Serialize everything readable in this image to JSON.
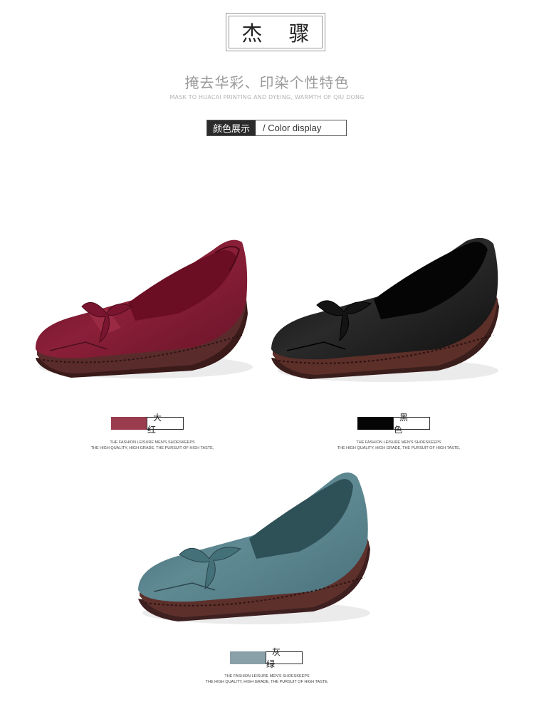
{
  "header": {
    "brand": "杰 骤",
    "slogan_cn": "掩去华彩、印染个性特色",
    "slogan_en": "MASK TO HUACAI PRINTING AND DYEING, WARMTH OF QIU DONG"
  },
  "section": {
    "title_cn": "颜色展示",
    "title_en": "/  Color display"
  },
  "products": [
    {
      "color_name": "大 红",
      "swatch_color": "#9b3c4e",
      "caption_line1": "THE FASHION LEISURE MEN'S SHOESKEEPS",
      "caption_line2": "THE HIGH QUALITY, HIGH GRADE, THE PURSUIT OF HIGH TASTE,"
    },
    {
      "color_name": "黑 色",
      "swatch_color": "#050505",
      "caption_line1": "THE FASHION LEISURE MEN'S SHOESKEEPS",
      "caption_line2": "THE HIGH QUALITY, HIGH GRADE, THE PURSUIT OF HIGH TASTE,"
    },
    {
      "color_name": "灰 绿",
      "swatch_color": "#8aa0a9",
      "caption_line1": "THE FASHION LEISURE MEN'S SHOESKEEPS",
      "caption_line2": "THE HIGH QUALITY, HIGH GRADE, THE PURSUIT OF HIGH TASTE,"
    }
  ]
}
